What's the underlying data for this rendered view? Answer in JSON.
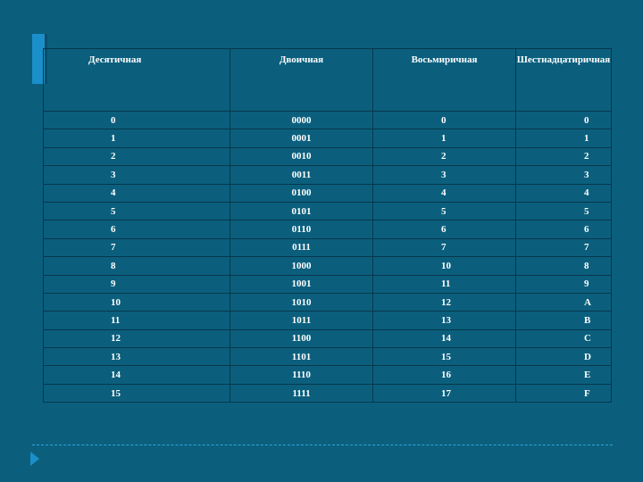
{
  "table": {
    "headers": [
      "Десятичная",
      "Двоичная",
      "Восьмиричная",
      "Шестнадцатиричная"
    ],
    "rows": [
      [
        "0",
        "0000",
        "0",
        "0"
      ],
      [
        "1",
        "0001",
        "1",
        "1"
      ],
      [
        "2",
        "0010",
        "2",
        "2"
      ],
      [
        "3",
        "0011",
        "3",
        "3"
      ],
      [
        "4",
        "0100",
        "4",
        "4"
      ],
      [
        "5",
        "0101",
        "5",
        "5"
      ],
      [
        "6",
        "0110",
        "6",
        "6"
      ],
      [
        "7",
        "0111",
        "7",
        "7"
      ],
      [
        "8",
        "1000",
        "10",
        "8"
      ],
      [
        "9",
        "1001",
        "11",
        "9"
      ],
      [
        "10",
        "1010",
        "12",
        "A"
      ],
      [
        "11",
        "1011",
        "13",
        "B"
      ],
      [
        "12",
        "1100",
        "14",
        "C"
      ],
      [
        "13",
        "1101",
        "15",
        "D"
      ],
      [
        "14",
        "1110",
        "16",
        "E"
      ],
      [
        "15",
        "1111",
        "17",
        "F"
      ]
    ]
  },
  "colors": {
    "background": "#0b5f7d",
    "accent": "#1b8fc9",
    "grid": "#07374b"
  },
  "icons": [
    "slide-accent-bar",
    "play-icon"
  ]
}
